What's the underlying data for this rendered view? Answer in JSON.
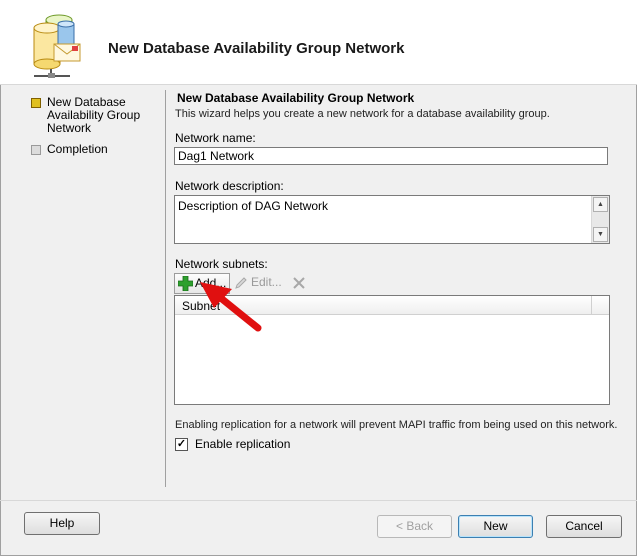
{
  "header": {
    "title": "New Database Availability Group Network",
    "icon": "database-network-icon"
  },
  "nav": {
    "items": [
      {
        "label": "New Database Availability Group Network",
        "state": "active"
      },
      {
        "label": "Completion",
        "state": "pending"
      }
    ]
  },
  "main": {
    "section_title": "New Database Availability Group Network",
    "section_desc": "This wizard helps you create a new network for a database availability group.",
    "network_name_label": "Network name:",
    "network_name_value": "Dag1 Network",
    "network_desc_label": "Network description:",
    "network_desc_value": "Description of DAG Network",
    "subnets_label": "Network subnets:",
    "toolbar": {
      "add_label": "Add...",
      "edit_label": "Edit..."
    },
    "subnets_table": {
      "columns": [
        "Subnet"
      ],
      "rows": []
    },
    "replication_note": "Enabling replication for a network will prevent MAPI traffic from being used on this network.",
    "enable_replication_label": "Enable replication",
    "enable_replication_checked": true
  },
  "buttons": {
    "help": "Help",
    "back": "< Back",
    "next": "New",
    "cancel": "Cancel"
  },
  "colors": {
    "active_marker": "#e0c020",
    "annotation_arrow": "#e01010",
    "add_icon": "#2ea02e"
  }
}
